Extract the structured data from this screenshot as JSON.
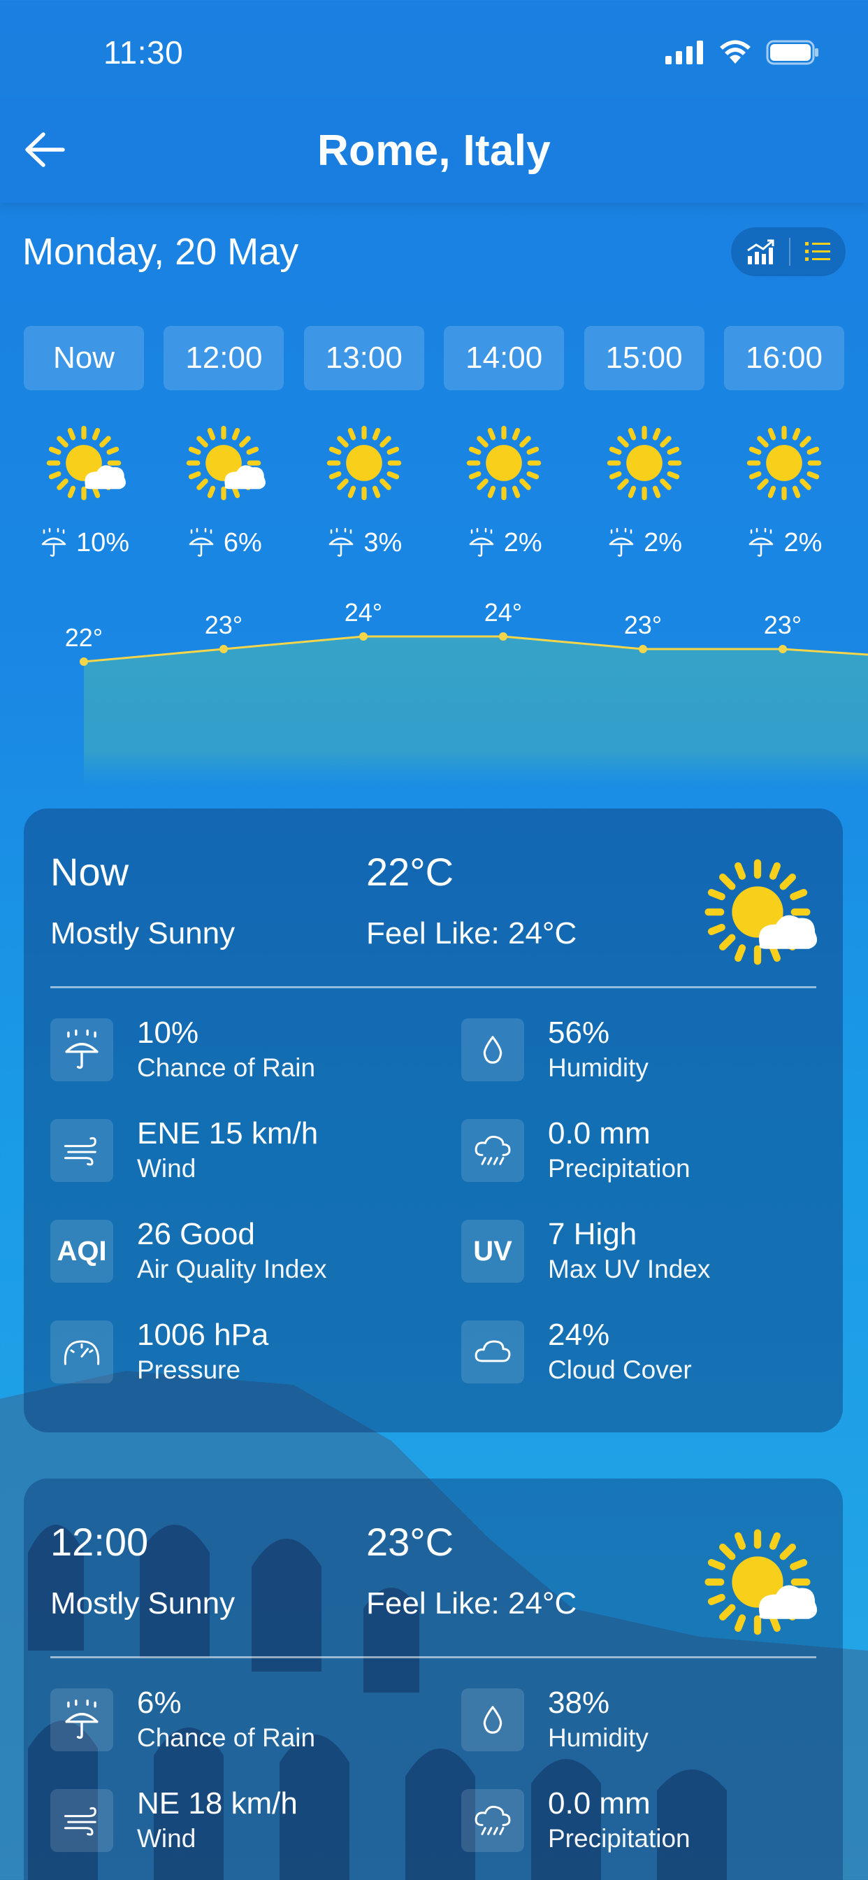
{
  "status_bar": {
    "time": "11:30"
  },
  "header": {
    "title": "Rome, Italy"
  },
  "date": "Monday, 20 May",
  "colors": {
    "sun": "#f8cf1b",
    "chart_line": "#f5d54a",
    "chart_fill": "#3aa6c4"
  },
  "hourly": [
    {
      "label": "Now",
      "icon": "partly-sunny-icon",
      "rain": "10%",
      "temp": "22°"
    },
    {
      "label": "12:00",
      "icon": "partly-sunny-icon",
      "rain": "6%",
      "temp": "23°"
    },
    {
      "label": "13:00",
      "icon": "sunny-icon",
      "rain": "3%",
      "temp": "24°"
    },
    {
      "label": "14:00",
      "icon": "sunny-icon",
      "rain": "2%",
      "temp": "24°"
    },
    {
      "label": "15:00",
      "icon": "sunny-icon",
      "rain": "2%",
      "temp": "23°"
    },
    {
      "label": "16:00",
      "icon": "sunny-icon",
      "rain": "2%",
      "temp": "23°"
    }
  ],
  "temperature_series": [
    22,
    23,
    24,
    24,
    23,
    23
  ],
  "cards": [
    {
      "time": "Now",
      "temp": "22°C",
      "condition": "Mostly Sunny",
      "feel": "Feel Like: 24°C",
      "metrics": {
        "rain_value": "10%",
        "rain_label": "Chance of Rain",
        "humidity_value": "56%",
        "humidity_label": "Humidity",
        "wind_value": "ENE 15 km/h",
        "wind_label": "Wind",
        "precip_value": "0.0 mm",
        "precip_label": "Precipitation",
        "aqi_badge": "AQI",
        "aqi_value": "26 Good",
        "aqi_label": "Air Quality Index",
        "uv_badge": "UV",
        "uv_value": "7 High",
        "uv_label": "Max UV Index",
        "pressure_value": "1006 hPa",
        "pressure_label": "Pressure",
        "cloud_value": "24%",
        "cloud_label": "Cloud Cover"
      }
    },
    {
      "time": "12:00",
      "temp": "23°C",
      "condition": "Mostly Sunny",
      "feel": "Feel Like: 24°C",
      "metrics": {
        "rain_value": "6%",
        "rain_label": "Chance of Rain",
        "humidity_value": "38%",
        "humidity_label": "Humidity",
        "wind_value": "NE 18 km/h",
        "wind_label": "Wind",
        "precip_value": "0.0 mm",
        "precip_label": "Precipitation"
      }
    }
  ]
}
